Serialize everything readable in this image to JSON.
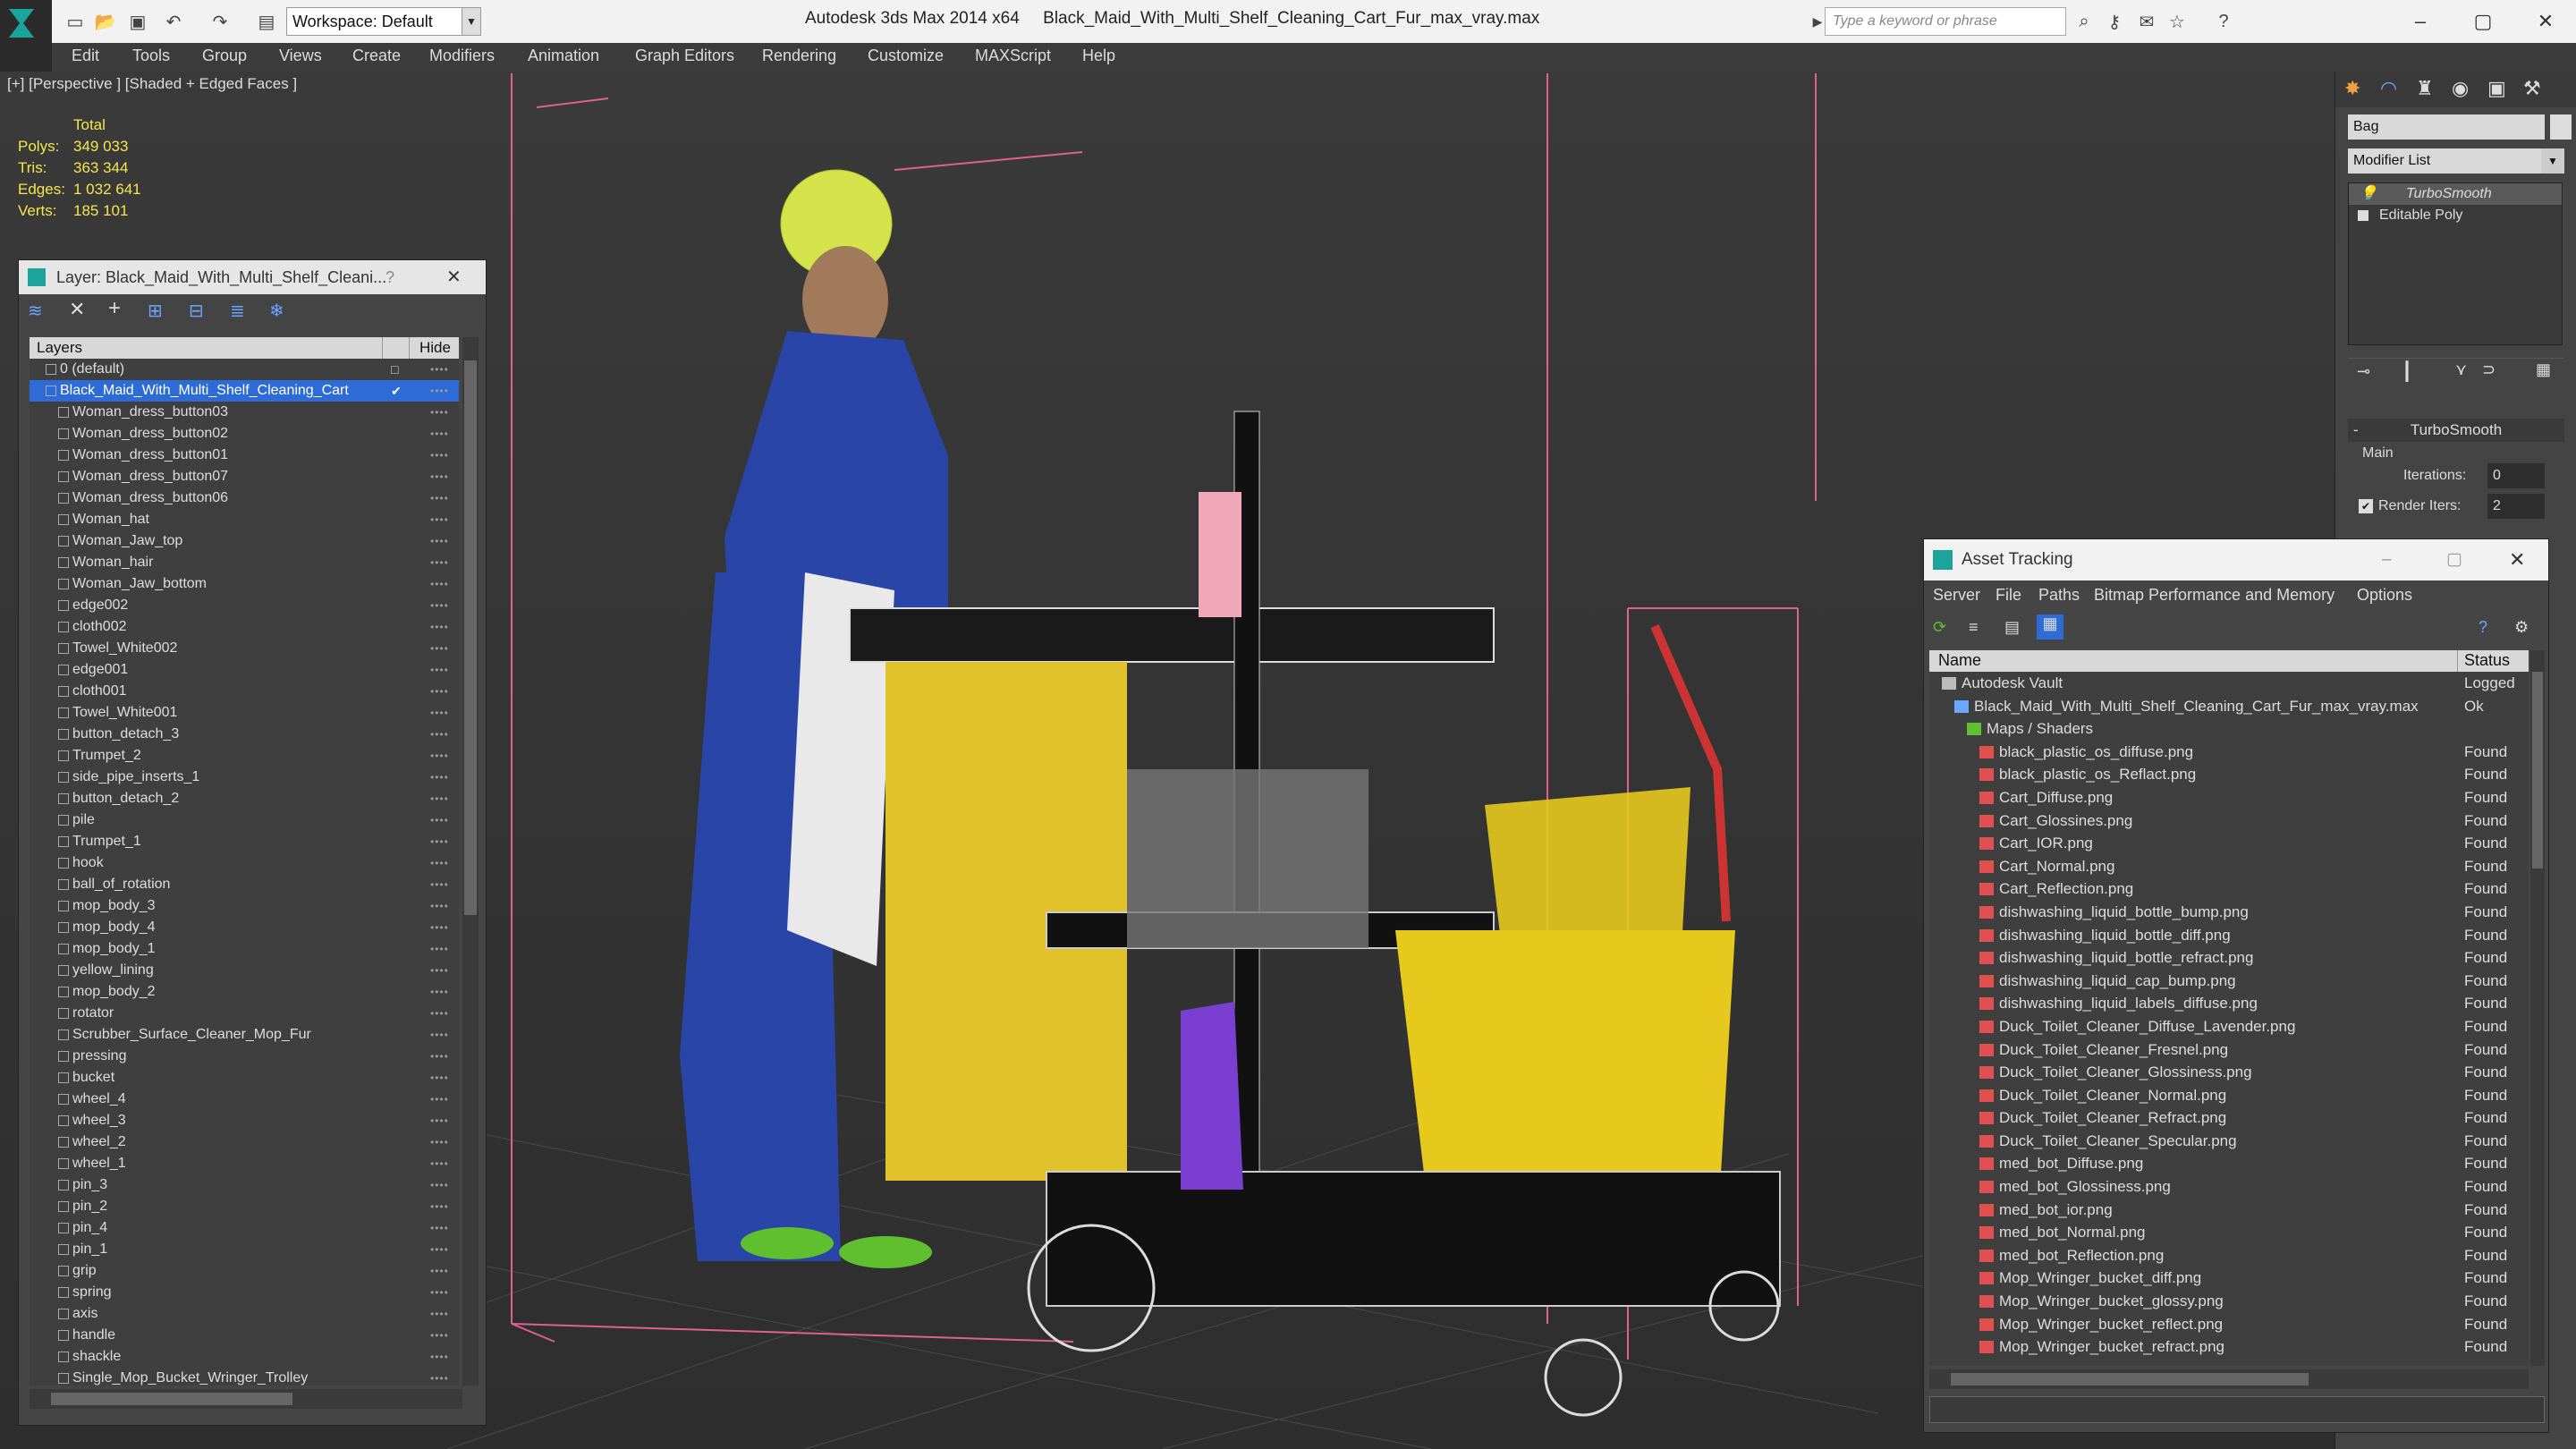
{
  "app": {
    "title": "Autodesk 3ds Max 2014 x64     Black_Maid_With_Multi_Shelf_Cleaning_Cart_Fur_max_vray.max",
    "workspace": "Workspace: Default",
    "search_placeholder": "Type a keyword or phrase"
  },
  "menu": [
    "Edit",
    "Tools",
    "Group",
    "Views",
    "Create",
    "Modifiers",
    "Animation",
    "Graph Editors",
    "Rendering",
    "Customize",
    "MAXScript",
    "Help"
  ],
  "viewport": {
    "label": "[+] [Perspective ] [Shaded + Edged Faces ]",
    "stats": {
      "header": "Total",
      "polys_label": "Polys:",
      "polys": "349 033",
      "tris_label": "Tris:",
      "tris": "363 344",
      "edges_label": "Edges:",
      "edges": "1 032 641",
      "verts_label": "Verts:",
      "verts": "185 101"
    }
  },
  "layer_panel": {
    "title": "Layer: Black_Maid_With_Multi_Shelf_Cleani...",
    "help": "?",
    "col_layers": "Layers",
    "col_hide": "Hide",
    "rows": [
      {
        "name": "0 (default)",
        "level": 1
      },
      {
        "name": "Black_Maid_With_Multi_Shelf_Cleaning_Cart",
        "level": 1,
        "selected": true
      },
      {
        "name": "Woman_dress_button03",
        "level": 2
      },
      {
        "name": "Woman_dress_button02",
        "level": 2
      },
      {
        "name": "Woman_dress_button01",
        "level": 2
      },
      {
        "name": "Woman_dress_button07",
        "level": 2
      },
      {
        "name": "Woman_dress_button06",
        "level": 2
      },
      {
        "name": "Woman_hat",
        "level": 2
      },
      {
        "name": "Woman_Jaw_top",
        "level": 2
      },
      {
        "name": "Woman_hair",
        "level": 2
      },
      {
        "name": "Woman_Jaw_bottom",
        "level": 2
      },
      {
        "name": "edge002",
        "level": 2
      },
      {
        "name": "cloth002",
        "level": 2
      },
      {
        "name": "Towel_White002",
        "level": 2
      },
      {
        "name": "edge001",
        "level": 2
      },
      {
        "name": "cloth001",
        "level": 2
      },
      {
        "name": "Towel_White001",
        "level": 2
      },
      {
        "name": "button_detach_3",
        "level": 2
      },
      {
        "name": "Trumpet_2",
        "level": 2
      },
      {
        "name": "side_pipe_inserts_1",
        "level": 2
      },
      {
        "name": "button_detach_2",
        "level": 2
      },
      {
        "name": "pile",
        "level": 2
      },
      {
        "name": "Trumpet_1",
        "level": 2
      },
      {
        "name": "hook",
        "level": 2
      },
      {
        "name": "ball_of_rotation",
        "level": 2
      },
      {
        "name": "mop_body_3",
        "level": 2
      },
      {
        "name": "mop_body_4",
        "level": 2
      },
      {
        "name": "mop_body_1",
        "level": 2
      },
      {
        "name": "yellow_lining",
        "level": 2
      },
      {
        "name": "mop_body_2",
        "level": 2
      },
      {
        "name": "rotator",
        "level": 2
      },
      {
        "name": "Scrubber_Surface_Cleaner_Mop_Fur",
        "level": 2
      },
      {
        "name": "pressing",
        "level": 2
      },
      {
        "name": "bucket",
        "level": 2
      },
      {
        "name": "wheel_4",
        "level": 2
      },
      {
        "name": "wheel_3",
        "level": 2
      },
      {
        "name": "wheel_2",
        "level": 2
      },
      {
        "name": "wheel_1",
        "level": 2
      },
      {
        "name": "pin_3",
        "level": 2
      },
      {
        "name": "pin_2",
        "level": 2
      },
      {
        "name": "pin_4",
        "level": 2
      },
      {
        "name": "pin_1",
        "level": 2
      },
      {
        "name": "grip",
        "level": 2
      },
      {
        "name": "spring",
        "level": 2
      },
      {
        "name": "axis",
        "level": 2
      },
      {
        "name": "handle",
        "level": 2
      },
      {
        "name": "shackle",
        "level": 2
      },
      {
        "name": "Single_Mop_Bucket_Wringer_Trolley",
        "level": 2
      }
    ]
  },
  "command_panel": {
    "object_name": "Bag",
    "modifier_list": "Modifier List",
    "stack": [
      "TurboSmooth",
      "Editable Poly"
    ],
    "rollout_title": "TurboSmooth",
    "group_main": "Main",
    "iterations_label": "Iterations:",
    "iterations_value": "0",
    "render_iters_label": "Render Iters:",
    "render_iters_value": "2"
  },
  "asset_tracking": {
    "title": "Asset Tracking",
    "menu": [
      "Server",
      "File",
      "Paths",
      "Bitmap Performance and Memory",
      "Options"
    ],
    "col_name": "Name",
    "col_status": "Status",
    "rows": [
      {
        "name": "Autodesk Vault",
        "status": "Logged",
        "level": 0,
        "icon": "vault"
      },
      {
        "name": "Black_Maid_With_Multi_Shelf_Cleaning_Cart_Fur_max_vray.max",
        "status": "Ok",
        "level": 1,
        "icon": "max"
      },
      {
        "name": "Maps / Shaders",
        "status": "",
        "level": 2,
        "icon": "maps"
      },
      {
        "name": "black_plastic_os_diffuse.png",
        "status": "Found",
        "level": 3,
        "icon": "png"
      },
      {
        "name": "black_plastic_os_Reflact.png",
        "status": "Found",
        "level": 3,
        "icon": "png"
      },
      {
        "name": "Cart_Diffuse.png",
        "status": "Found",
        "level": 3,
        "icon": "png"
      },
      {
        "name": "Cart_Glossines.png",
        "status": "Found",
        "level": 3,
        "icon": "png"
      },
      {
        "name": "Cart_IOR.png",
        "status": "Found",
        "level": 3,
        "icon": "png"
      },
      {
        "name": "Cart_Normal.png",
        "status": "Found",
        "level": 3,
        "icon": "png"
      },
      {
        "name": "Cart_Reflection.png",
        "status": "Found",
        "level": 3,
        "icon": "png"
      },
      {
        "name": "dishwashing_liquid_bottle_bump.png",
        "status": "Found",
        "level": 3,
        "icon": "png"
      },
      {
        "name": "dishwashing_liquid_bottle_diff.png",
        "status": "Found",
        "level": 3,
        "icon": "png"
      },
      {
        "name": "dishwashing_liquid_bottle_refract.png",
        "status": "Found",
        "level": 3,
        "icon": "png"
      },
      {
        "name": "dishwashing_liquid_cap_bump.png",
        "status": "Found",
        "level": 3,
        "icon": "png"
      },
      {
        "name": "dishwashing_liquid_labels_diffuse.png",
        "status": "Found",
        "level": 3,
        "icon": "png"
      },
      {
        "name": "Duck_Toilet_Cleaner_Diffuse_Lavender.png",
        "status": "Found",
        "level": 3,
        "icon": "png"
      },
      {
        "name": "Duck_Toilet_Cleaner_Fresnel.png",
        "status": "Found",
        "level": 3,
        "icon": "png"
      },
      {
        "name": "Duck_Toilet_Cleaner_Glossiness.png",
        "status": "Found",
        "level": 3,
        "icon": "png"
      },
      {
        "name": "Duck_Toilet_Cleaner_Normal.png",
        "status": "Found",
        "level": 3,
        "icon": "png"
      },
      {
        "name": "Duck_Toilet_Cleaner_Refract.png",
        "status": "Found",
        "level": 3,
        "icon": "png"
      },
      {
        "name": "Duck_Toilet_Cleaner_Specular.png",
        "status": "Found",
        "level": 3,
        "icon": "png"
      },
      {
        "name": "med_bot_Diffuse.png",
        "status": "Found",
        "level": 3,
        "icon": "png"
      },
      {
        "name": "med_bot_Glossiness.png",
        "status": "Found",
        "level": 3,
        "icon": "png"
      },
      {
        "name": "med_bot_ior.png",
        "status": "Found",
        "level": 3,
        "icon": "png"
      },
      {
        "name": "med_bot_Normal.png",
        "status": "Found",
        "level": 3,
        "icon": "png"
      },
      {
        "name": "med_bot_Reflection.png",
        "status": "Found",
        "level": 3,
        "icon": "png"
      },
      {
        "name": "Mop_Wringer_bucket_diff.png",
        "status": "Found",
        "level": 3,
        "icon": "png"
      },
      {
        "name": "Mop_Wringer_bucket_glossy.png",
        "status": "Found",
        "level": 3,
        "icon": "png"
      },
      {
        "name": "Mop_Wringer_bucket_reflect.png",
        "status": "Found",
        "level": 3,
        "icon": "png"
      },
      {
        "name": "Mop_Wringer_bucket_refract.png",
        "status": "Found",
        "level": 3,
        "icon": "png"
      }
    ]
  }
}
